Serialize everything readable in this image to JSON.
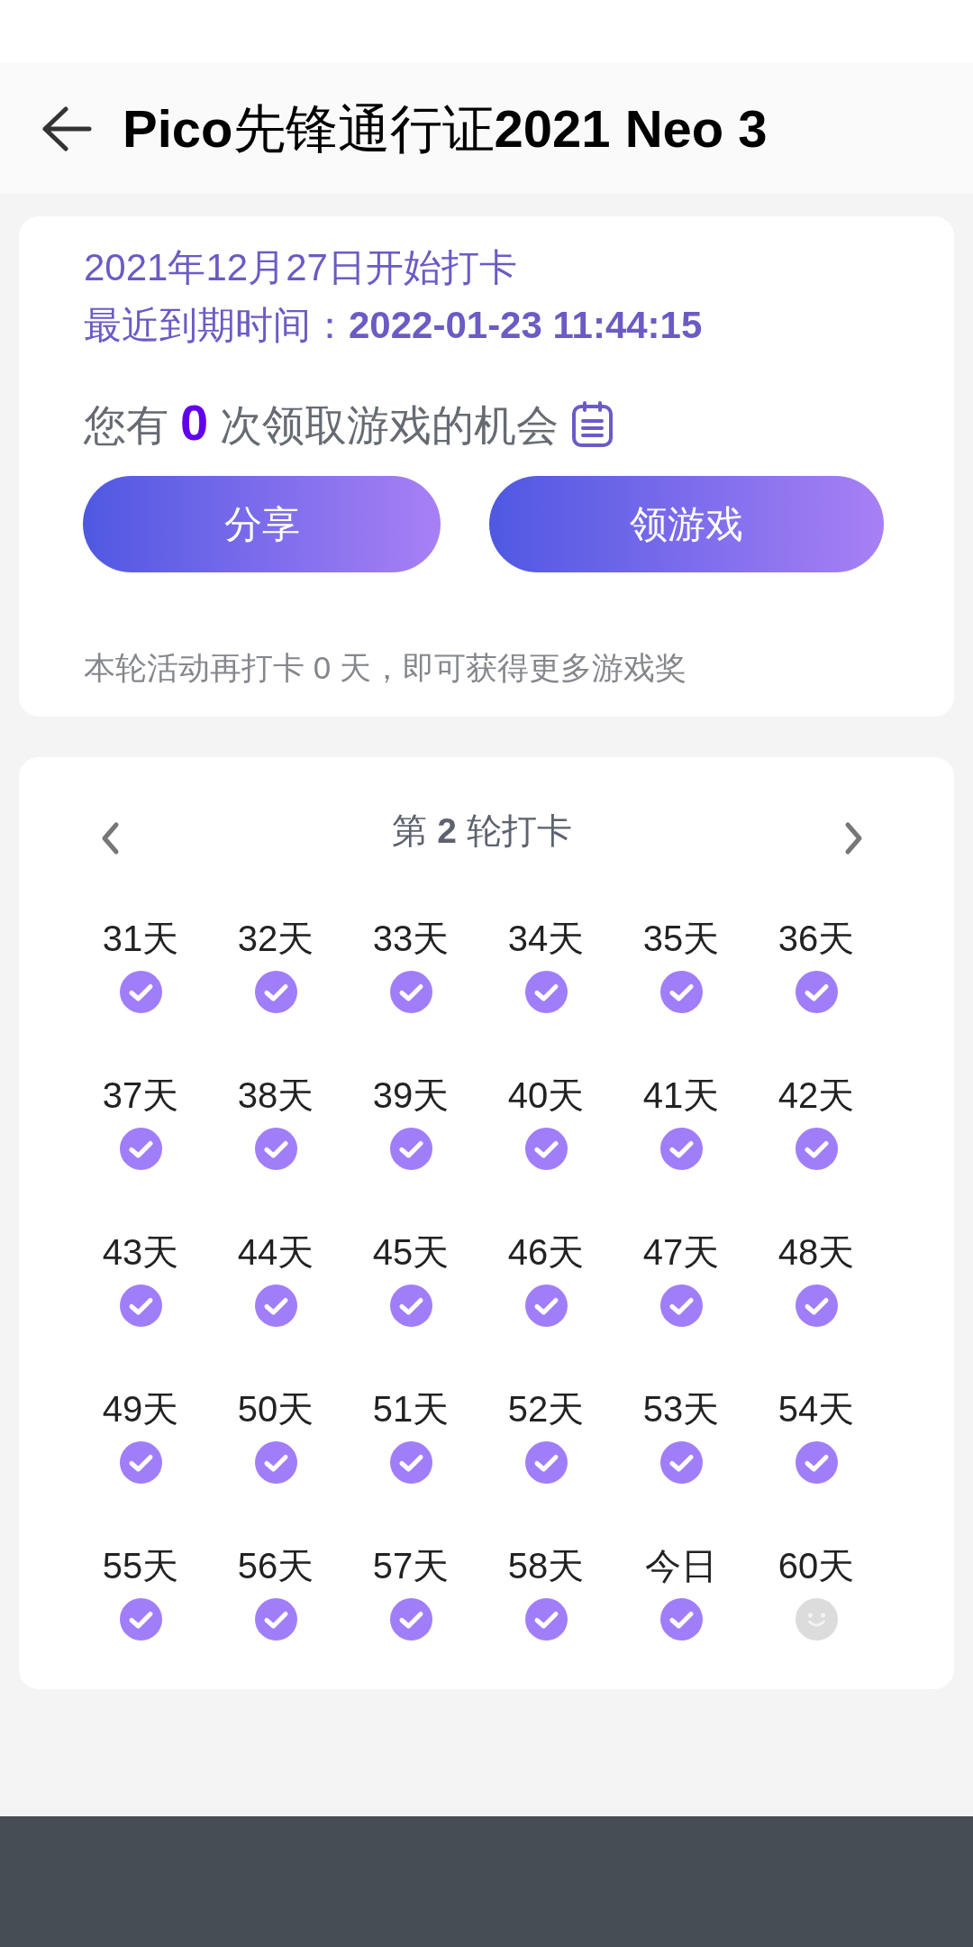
{
  "app_bar": {
    "title": "**Pico**先锋通行证**2021 Neo 3**"
  },
  "summary_card": {
    "start_line": "2021年12月27日开始打卡",
    "expiry_line": "最近到期时间：**2022-01-23 11:44:15**",
    "chances": "您有 **0** 次领取游戏的机会",
    "buttons": [
      {
        "label": "分享"
      },
      {
        "label": "领游戏"
      }
    ],
    "note": "本轮活动再打卡 0 天，即可获得更多游戏奖"
  },
  "checkin_card": {
    "round_title": "第 **2** 轮打卡",
    "days": [
      {
        "label": "31天",
        "checked": true
      },
      {
        "label": "32天",
        "checked": true
      },
      {
        "label": "33天",
        "checked": true
      },
      {
        "label": "34天",
        "checked": true
      },
      {
        "label": "35天",
        "checked": true
      },
      {
        "label": "36天",
        "checked": true
      },
      {
        "label": "37天",
        "checked": true
      },
      {
        "label": "38天",
        "checked": true
      },
      {
        "label": "39天",
        "checked": true
      },
      {
        "label": "40天",
        "checked": true
      },
      {
        "label": "41天",
        "checked": true
      },
      {
        "label": "42天",
        "checked": true
      },
      {
        "label": "43天",
        "checked": true
      },
      {
        "label": "44天",
        "checked": true
      },
      {
        "label": "45天",
        "checked": true
      },
      {
        "label": "46天",
        "checked": true
      },
      {
        "label": "47天",
        "checked": true
      },
      {
        "label": "48天",
        "checked": true
      },
      {
        "label": "49天",
        "checked": true
      },
      {
        "label": "50天",
        "checked": true
      },
      {
        "label": "51天",
        "checked": true
      },
      {
        "label": "52天",
        "checked": true
      },
      {
        "label": "53天",
        "checked": true
      },
      {
        "label": "54天",
        "checked": true
      },
      {
        "label": "55天",
        "checked": true
      },
      {
        "label": "56天",
        "checked": true
      },
      {
        "label": "57天",
        "checked": true
      },
      {
        "label": "58天",
        "checked": true
      },
      {
        "label": "今日",
        "checked": true
      },
      {
        "label": "60天",
        "checked": false
      }
    ]
  }
}
